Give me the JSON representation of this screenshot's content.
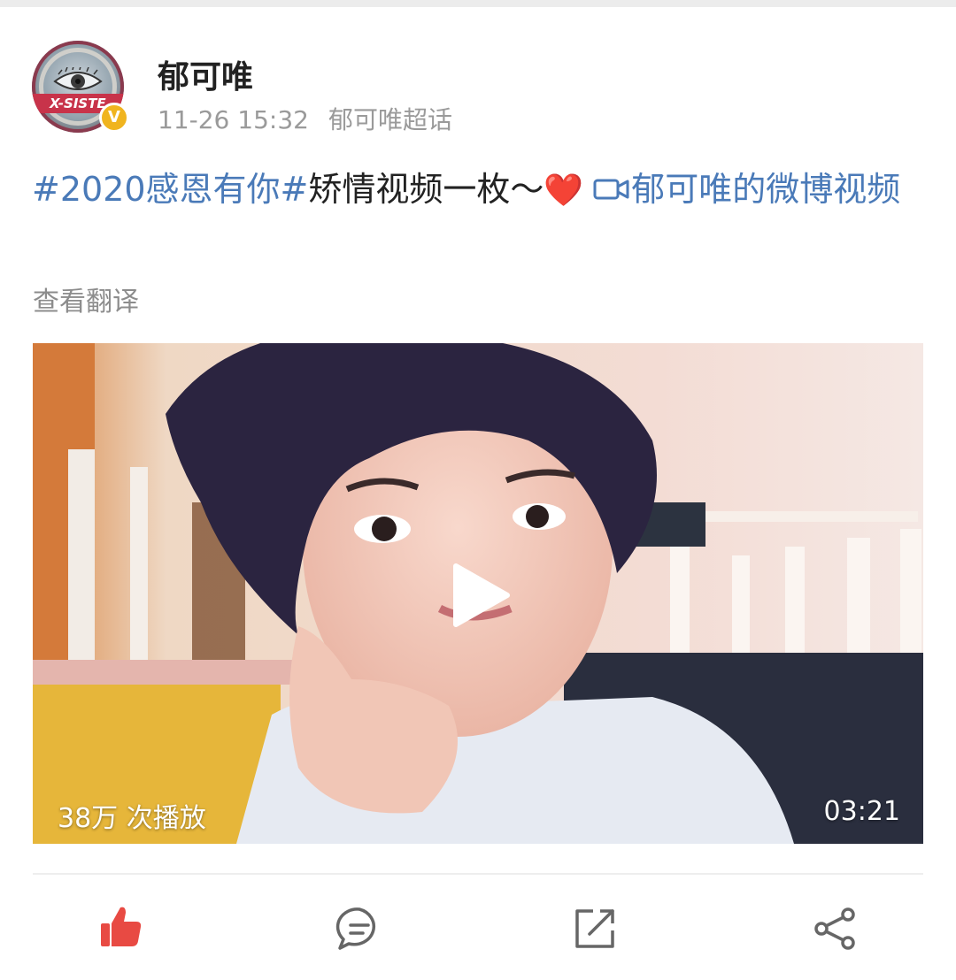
{
  "post": {
    "author": "郁可唯",
    "time": "11-26 15:32",
    "source": "郁可唯超话",
    "avatar_label": "X-SISTE",
    "verified_mark": "V",
    "hashtag": "#2020感恩有你#",
    "text": "矫情视频一枚～",
    "heart": "❤️",
    "video_link_text": "郁可唯的微博视频",
    "translate": "查看翻译"
  },
  "video": {
    "plays": "38万 次播放",
    "duration": "03:21"
  },
  "actions": {
    "like_icon": "thumbs-up-icon",
    "comment_icon": "comment-icon",
    "repost_icon": "repost-icon",
    "share_icon": "share-icon"
  },
  "colors": {
    "link": "#4a7ab8",
    "like_active": "#e84a43",
    "muted": "#9a9a9a"
  }
}
